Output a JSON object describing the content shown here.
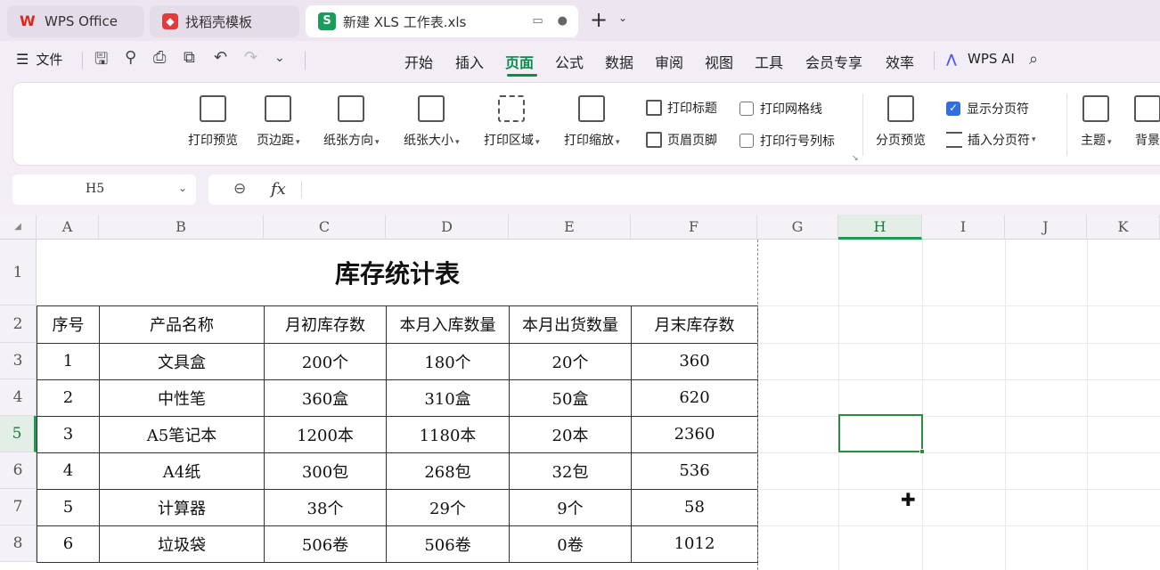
{
  "tabs": [
    {
      "label": "WPS Office"
    },
    {
      "label": "找稻壳模板"
    },
    {
      "label": "新建 XLS 工作表.xls"
    }
  ],
  "menu": {
    "file": "文件",
    "tabs": [
      "开始",
      "插入",
      "页面",
      "公式",
      "数据",
      "审阅",
      "视图",
      "工具",
      "会员专享",
      "效率"
    ],
    "active_tab": "页面",
    "ai": "WPS AI"
  },
  "ribbon": {
    "print_preview": "打印预览",
    "margins": "页边距",
    "orientation": "纸张方向",
    "paper_size": "纸张大小",
    "print_area": "打印区域",
    "print_scale": "打印缩放",
    "print_titles": "打印标题",
    "header_footer": "页眉页脚",
    "print_gridlines": "打印网格线",
    "print_row_col_headers": "打印行号列标",
    "page_break_preview": "分页预览",
    "show_page_breaks": "显示分页符",
    "insert_page_break": "插入分页符",
    "theme": "主题",
    "background": "背景"
  },
  "formula_bar": {
    "cell_ref": "H5",
    "fx": "fx"
  },
  "sheet": {
    "columns": [
      "A",
      "B",
      "C",
      "D",
      "E",
      "F",
      "G",
      "H",
      "I",
      "J",
      "K"
    ],
    "rows": [
      "1",
      "2",
      "3",
      "4",
      "5",
      "6",
      "7",
      "8"
    ],
    "selected_column": "H",
    "selected_row": "5",
    "title": "库存统计表",
    "headers": [
      "序号",
      "产品名称",
      "月初库存数",
      "本月入库数量",
      "本月出货数量",
      "月末库存数"
    ],
    "data": [
      [
        "1",
        "文具盒",
        "200个",
        "180个",
        "20个",
        "360"
      ],
      [
        "2",
        "中性笔",
        "360盒",
        "310盒",
        "50盒",
        "620"
      ],
      [
        "3",
        "A5笔记本",
        "1200本",
        "1180本",
        "20本",
        "2360"
      ],
      [
        "4",
        "A4纸",
        "300包",
        "268包",
        "32包",
        "536"
      ],
      [
        "5",
        "计算器",
        "38个",
        "29个",
        "9个",
        "58"
      ],
      [
        "6",
        "垃圾袋",
        "506卷",
        "506卷",
        "0卷",
        "1012"
      ]
    ]
  }
}
